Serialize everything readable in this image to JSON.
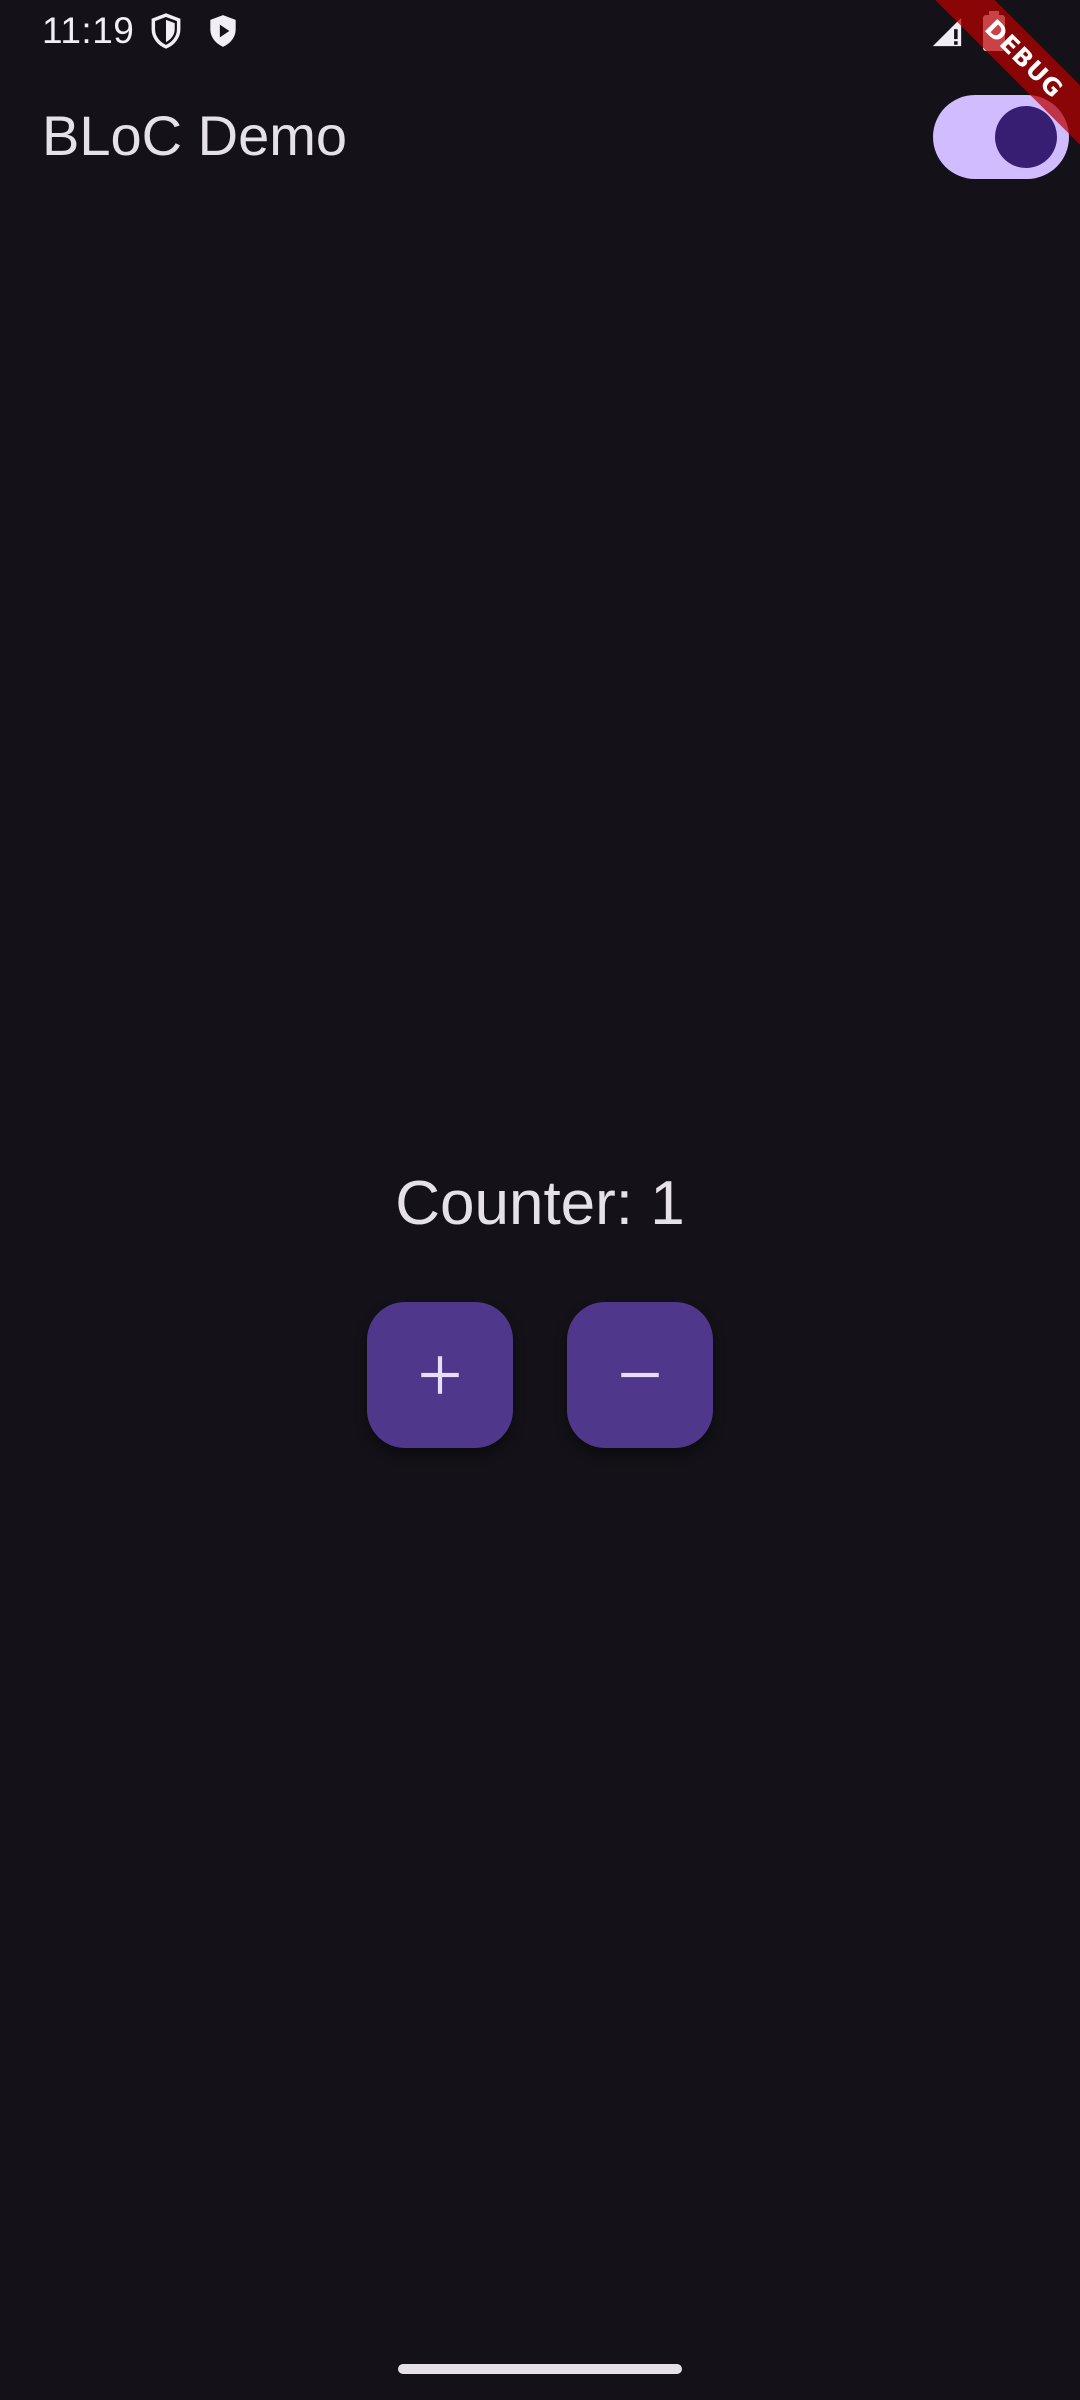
{
  "status_bar": {
    "time": "11:19",
    "icons": [
      "shield-outline-icon",
      "play-protect-icon",
      "signal-icon",
      "battery-icon"
    ]
  },
  "app_bar": {
    "title": "BLoC Demo",
    "theme_switch_on": true
  },
  "debug_banner": {
    "label": "DEBUG"
  },
  "counter": {
    "label": "Counter: 1"
  },
  "actions": {
    "increment_icon": "plus-icon",
    "decrement_icon": "minus-icon"
  },
  "colors": {
    "background": "#141218",
    "on_surface": "#E6E0E9",
    "primary": "#D0BCFF",
    "on_primary": "#381E72",
    "fab_container": "#4F378B",
    "debug_banner": "#B80000"
  }
}
